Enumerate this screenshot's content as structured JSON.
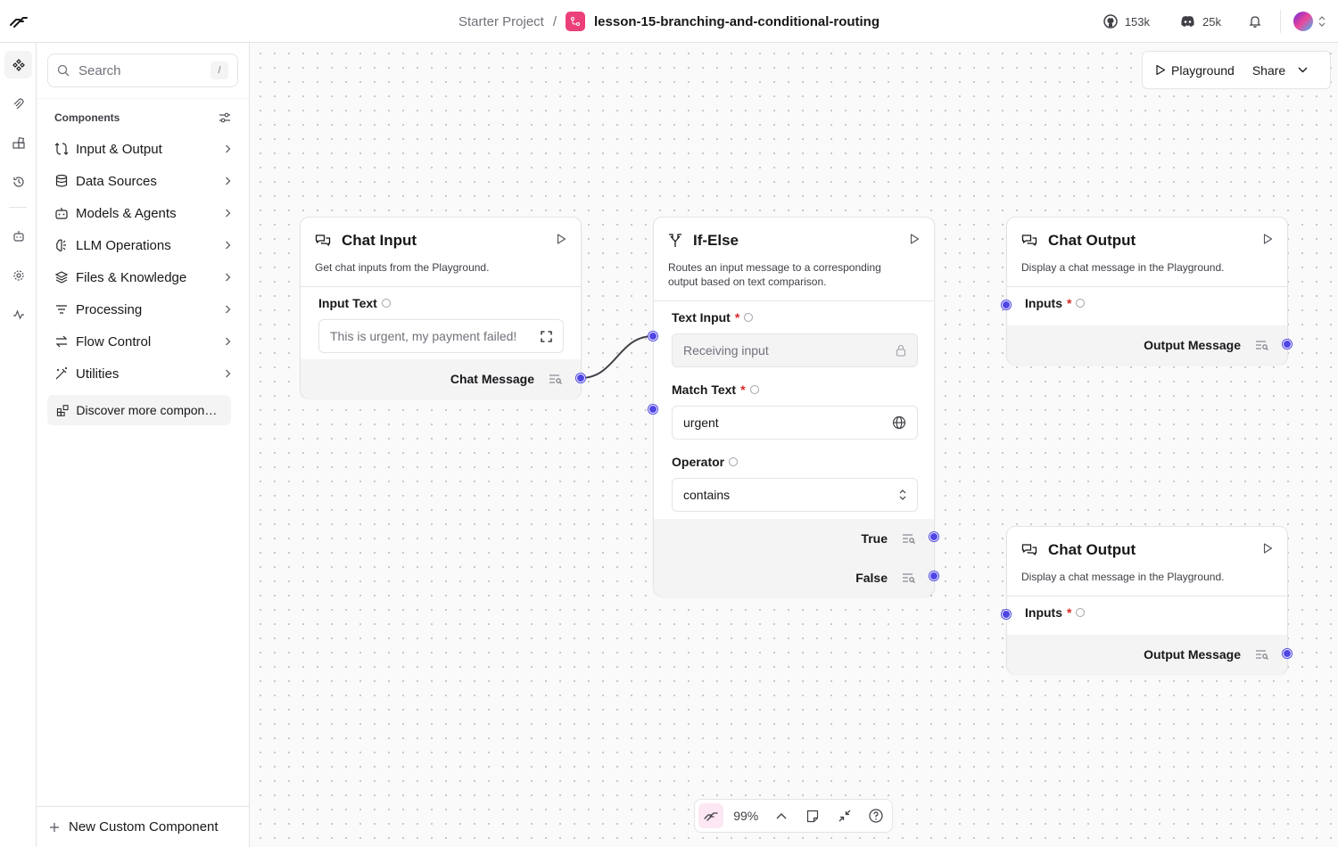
{
  "header": {
    "project": "Starter Project",
    "separator": "/",
    "flow_name": "lesson-15-branching-and-conditional-routing",
    "github_count": "153k",
    "discord_count": "25k"
  },
  "sidebar": {
    "search_placeholder": "Search",
    "search_shortcut": "/",
    "components_title": "Components",
    "categories": [
      {
        "label": "Input & Output",
        "icon": "input-output-icon"
      },
      {
        "label": "Data Sources",
        "icon": "database-icon"
      },
      {
        "label": "Models & Agents",
        "icon": "bot-icon"
      },
      {
        "label": "LLM Operations",
        "icon": "brain-icon"
      },
      {
        "label": "Files & Knowledge",
        "icon": "layers-icon"
      },
      {
        "label": "Processing",
        "icon": "filter-icon"
      },
      {
        "label": "Flow Control",
        "icon": "arrows-icon"
      },
      {
        "label": "Utilities",
        "icon": "wand-icon"
      }
    ],
    "discover_label": "Discover more components",
    "new_component_label": "New Custom Component"
  },
  "toolbar": {
    "playground_label": "Playground",
    "share_label": "Share"
  },
  "nodes": {
    "chat_input": {
      "title": "Chat Input",
      "description": "Get chat inputs from the Playground.",
      "field_label": "Input Text",
      "field_value": "This is urgent, my payment failed!",
      "output_label": "Chat Message"
    },
    "if_else": {
      "title": "If-Else",
      "description": "Routes an input message to a corresponding output based on text comparison.",
      "text_input_label": "Text Input",
      "text_input_value": "Receiving input",
      "match_text_label": "Match Text",
      "match_text_value": "urgent",
      "operator_label": "Operator",
      "operator_value": "contains",
      "true_label": "True",
      "false_label": "False"
    },
    "chat_output_1": {
      "title": "Chat Output",
      "description": "Display a chat message in the Playground.",
      "inputs_label": "Inputs",
      "output_label": "Output Message"
    },
    "chat_output_2": {
      "title": "Chat Output",
      "description": "Display a chat message in the Playground.",
      "inputs_label": "Inputs",
      "output_label": "Output Message"
    }
  },
  "controls": {
    "zoom": "99%"
  },
  "colors": {
    "handle": "#4f46e5",
    "flow_badge": "#ec407a",
    "required": "#dc2626"
  }
}
